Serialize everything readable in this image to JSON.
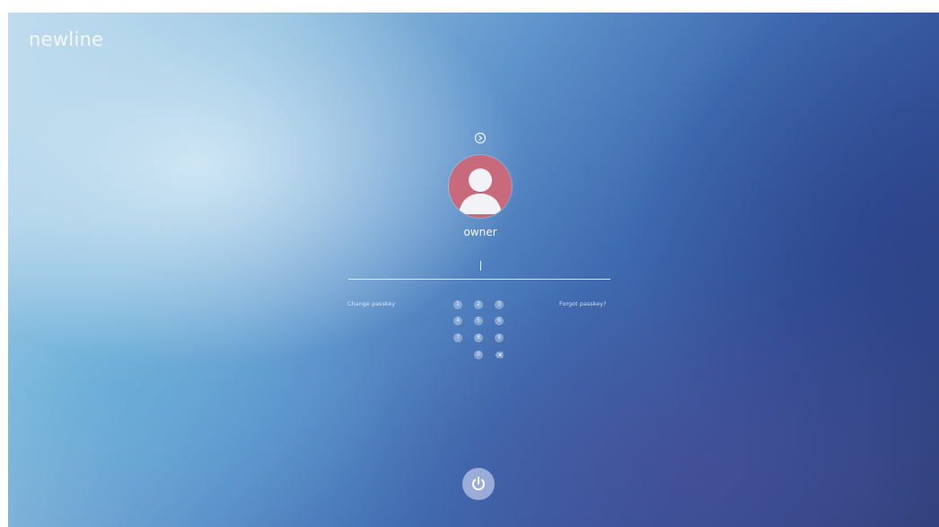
{
  "brand": {
    "logo_text": "newline"
  },
  "user": {
    "name": "owner"
  },
  "links": {
    "change_passkey": "Change passkey",
    "forgot_passkey": "Forgot passkey?"
  },
  "keypad": {
    "keys": [
      "1",
      "2",
      "3",
      "4",
      "5",
      "6",
      "7",
      "8",
      "9",
      "0"
    ],
    "backspace_icon": "backspace-icon"
  },
  "icons": {
    "switch_user": "switch-user-icon",
    "avatar": "user-avatar-icon",
    "power": "power-icon"
  },
  "colors": {
    "avatar_bg": "#c86a7c",
    "power_bg": "#aab9e1"
  }
}
